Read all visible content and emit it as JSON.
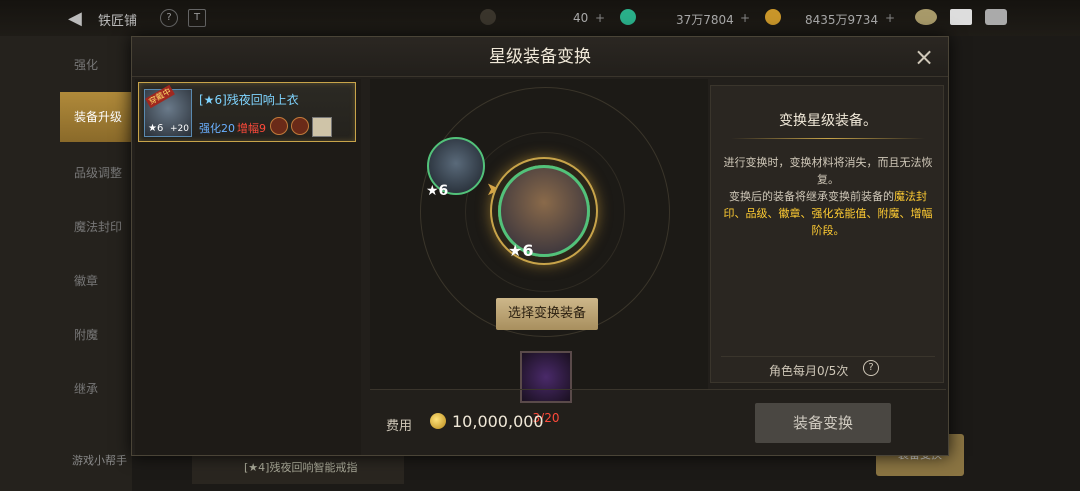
{
  "topbar": {
    "title": "铁匠铺",
    "gem_count": "40",
    "currency1": "37万7804",
    "currency2": "8435万9734"
  },
  "sidebar": {
    "items": [
      "强化",
      "装备升级",
      "品级调整",
      "魔法封印",
      "徽章",
      "附魔",
      "继承"
    ],
    "bottom_label": "游戏小帮手",
    "bottom_item_label": "[★4]残夜回响智能戒指",
    "bottom_btn": "装备变换"
  },
  "modal": {
    "title": "星级装备变换",
    "close": "×"
  },
  "item": {
    "badge": "穿戴中",
    "name": "[★6]残夜回响上衣",
    "star": "6",
    "plus": "+20",
    "enhance": "强化20",
    "amp": "增幅9"
  },
  "transfer": {
    "src_star": "★6",
    "target_star": "★6",
    "select_label": "选择变换装备",
    "material_count": "3/20"
  },
  "info": {
    "title": "变换星级装备。",
    "desc_plain1": "进行变换时，变换材料将消失，而且无法恢复。",
    "desc_plain2": "变换后的装备将继承变换前装备的",
    "desc_highlight": "魔法封印、品级、徽章、强化充能值、附魔、增幅阶段。",
    "monthly": "角色每月0/5次",
    "help": "?"
  },
  "footer": {
    "cost_label": "费用",
    "cost_value": "10,000,000",
    "convert_label": "装备变换"
  },
  "colors": {
    "accent_gold": "#c8a44a",
    "rarity_green": "#52c27a",
    "amp_red": "#ff4a3a",
    "highlight_yellow": "#ffcc33"
  }
}
